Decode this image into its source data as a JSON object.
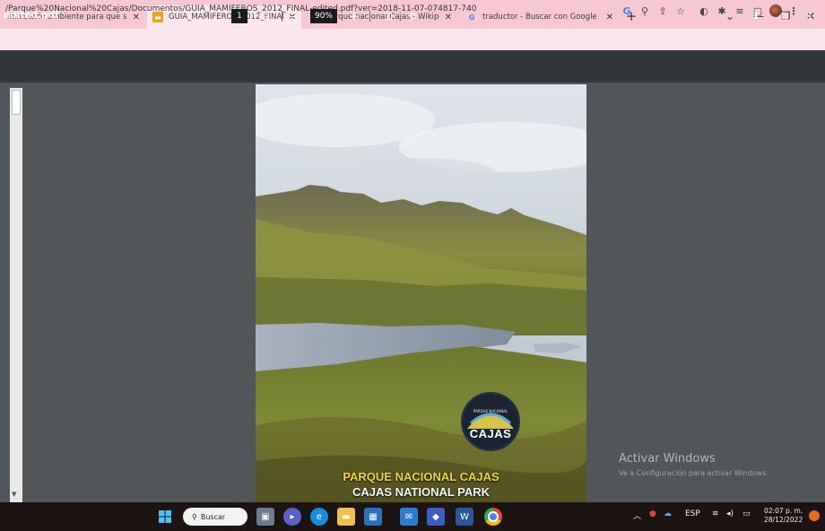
{
  "browser": {
    "tabs": [
      {
        "title": "ministerio ambiente para que sir",
        "close": "✕",
        "active": false
      },
      {
        "title": "GUIA_MAMIFEROS_2012_FINAL-",
        "close": "✕",
        "active": true
      },
      {
        "title": "Parque nacional Cajas - Wikipedi",
        "close": "✕",
        "active": false
      },
      {
        "title": "traductor - Buscar con Google",
        "close": "✕",
        "active": false
      }
    ],
    "new_tab": "+",
    "url": "/Parque%20Nacional%20Cajas/Documentos/GUIA_MAMIFEROS_2012_FINAL-edited.pdf?ver=2018-11-07-074817-740"
  },
  "pdf_toolbar": {
    "filename": "edited.pdf",
    "page_current": "1",
    "page_total": "/ 78",
    "zoom": "90%",
    "zoom_out": "—",
    "zoom_in": "+"
  },
  "pdf_page": {
    "title_es": "PARQUE NACIONAL CAJAS",
    "title_en": "CAJAS NATIONAL PARK",
    "logo_text": "CAJAS",
    "logo_small": "PARQUE NACIONAL"
  },
  "watermark": {
    "line1": "Activar Windows",
    "line2": "Ve a Configuración para activar Windows."
  },
  "taskbar": {
    "search_label": "Buscar",
    "language": "ESP",
    "time": "02:07 p. m.",
    "date": "28/12/2022"
  },
  "colors": {
    "tab_strip": "#f7c8d3",
    "pdf_toolbar": "#323639",
    "viewer_bg": "#525659",
    "title_yellow": "#f2d53c"
  }
}
